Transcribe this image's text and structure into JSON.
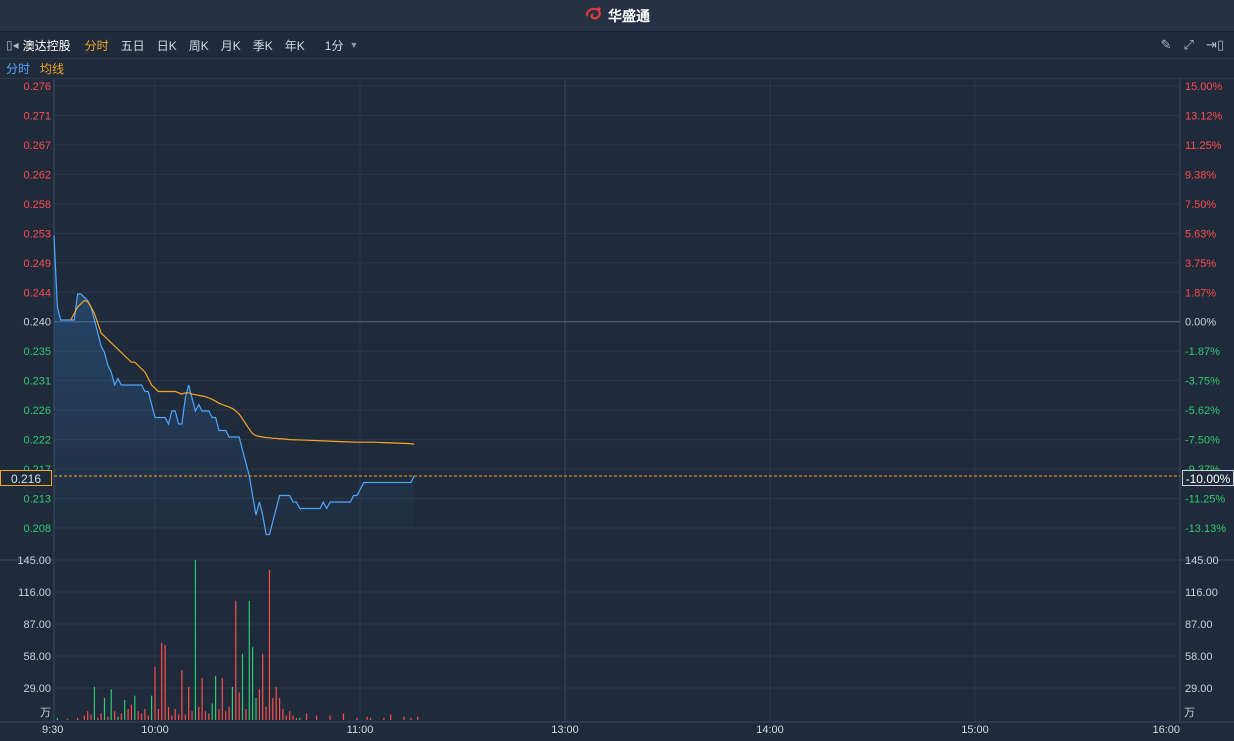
{
  "brand": {
    "name": "华盛通",
    "logo_icon": "huasheng-logo-icon"
  },
  "toolbar": {
    "stock_name": "澳达控股",
    "tabs": [
      "分时",
      "五日",
      "日K",
      "周K",
      "月K",
      "季K",
      "年K"
    ],
    "active_tab": "分时",
    "period": "1分",
    "icons": [
      "collapse-panel-icon",
      "pencil-icon",
      "fullscreen-icon",
      "exit-icon"
    ]
  },
  "legend": {
    "series1": "分时",
    "series2": "均线"
  },
  "colors": {
    "price_line": "#4fa8ff",
    "avg_line": "#f5a623",
    "up": "#ff4d4d",
    "down": "#2ecc71",
    "baseline": "#5a6b80",
    "grid": "#2b3849"
  },
  "chart_data": {
    "type": "line",
    "prev_close": 0.24,
    "price_ticks_left": [
      "0.276",
      "0.271",
      "0.267",
      "0.262",
      "0.258",
      "0.253",
      "0.249",
      "0.244",
      "0.240",
      "0.235",
      "0.231",
      "0.226",
      "0.222",
      "0.217",
      "0.213",
      "0.208"
    ],
    "pct_ticks_right": [
      "15.00%",
      "13.12%",
      "11.25%",
      "9.38%",
      "7.50%",
      "5.63%",
      "3.75%",
      "1.87%",
      "0.00%",
      "-1.87%",
      "-3.75%",
      "-5.62%",
      "-7.50%",
      "-9.37%",
      "-11.25%",
      "-13.13%"
    ],
    "volume_ticks": [
      "145.00",
      "116.00",
      "87.00",
      "58.00",
      "29.00"
    ],
    "volume_unit": "万",
    "x_labels": [
      "9:30",
      "10:00",
      "11:00",
      "13:00",
      "14:00",
      "15:00",
      "16:00"
    ],
    "current_price": "0.216",
    "current_pct": "-10.00%",
    "price_series": [
      [
        0,
        0.253
      ],
      [
        1,
        0.242
      ],
      [
        2,
        0.24
      ],
      [
        3,
        0.24
      ],
      [
        4,
        0.24
      ],
      [
        5,
        0.24
      ],
      [
        6,
        0.24
      ],
      [
        7,
        0.244
      ],
      [
        8,
        0.244
      ],
      [
        9,
        0.2435
      ],
      [
        10,
        0.243
      ],
      [
        11,
        0.242
      ],
      [
        12,
        0.24
      ],
      [
        13,
        0.238
      ],
      [
        14,
        0.236
      ],
      [
        15,
        0.235
      ],
      [
        16,
        0.233
      ],
      [
        17,
        0.232
      ],
      [
        18,
        0.23
      ],
      [
        19,
        0.231
      ],
      [
        20,
        0.23
      ],
      [
        21,
        0.23
      ],
      [
        22,
        0.23
      ],
      [
        23,
        0.23
      ],
      [
        24,
        0.23
      ],
      [
        25,
        0.23
      ],
      [
        26,
        0.23
      ],
      [
        27,
        0.229
      ],
      [
        28,
        0.229
      ],
      [
        29,
        0.227
      ],
      [
        30,
        0.225
      ],
      [
        31,
        0.225
      ],
      [
        32,
        0.225
      ],
      [
        33,
        0.225
      ],
      [
        34,
        0.224
      ],
      [
        35,
        0.226
      ],
      [
        36,
        0.226
      ],
      [
        37,
        0.224
      ],
      [
        38,
        0.224
      ],
      [
        39,
        0.228
      ],
      [
        40,
        0.23
      ],
      [
        41,
        0.228
      ],
      [
        42,
        0.226
      ],
      [
        43,
        0.227
      ],
      [
        44,
        0.226
      ],
      [
        45,
        0.226
      ],
      [
        46,
        0.226
      ],
      [
        47,
        0.225
      ],
      [
        48,
        0.225
      ],
      [
        49,
        0.223
      ],
      [
        50,
        0.223
      ],
      [
        51,
        0.223
      ],
      [
        52,
        0.222
      ],
      [
        53,
        0.222
      ],
      [
        54,
        0.222
      ],
      [
        55,
        0.222
      ],
      [
        56,
        0.22
      ],
      [
        57,
        0.218
      ],
      [
        58,
        0.216
      ],
      [
        59,
        0.213
      ],
      [
        60,
        0.21
      ],
      [
        61,
        0.212
      ],
      [
        62,
        0.21
      ],
      [
        63,
        0.207
      ],
      [
        64,
        0.207
      ],
      [
        65,
        0.209
      ],
      [
        66,
        0.211
      ],
      [
        67,
        0.213
      ],
      [
        68,
        0.213
      ],
      [
        69,
        0.213
      ],
      [
        70,
        0.213
      ],
      [
        71,
        0.212
      ],
      [
        72,
        0.212
      ],
      [
        73,
        0.211
      ],
      [
        74,
        0.211
      ],
      [
        75,
        0.211
      ],
      [
        76,
        0.211
      ],
      [
        77,
        0.211
      ],
      [
        78,
        0.211
      ],
      [
        79,
        0.211
      ],
      [
        80,
        0.212
      ],
      [
        81,
        0.211
      ],
      [
        82,
        0.212
      ],
      [
        83,
        0.212
      ],
      [
        84,
        0.212
      ],
      [
        85,
        0.212
      ],
      [
        86,
        0.212
      ],
      [
        87,
        0.212
      ],
      [
        88,
        0.212
      ],
      [
        89,
        0.213
      ],
      [
        90,
        0.213
      ],
      [
        91,
        0.214
      ],
      [
        92,
        0.215
      ],
      [
        93,
        0.215
      ],
      [
        94,
        0.215
      ],
      [
        95,
        0.215
      ],
      [
        96,
        0.215
      ],
      [
        97,
        0.215
      ],
      [
        98,
        0.215
      ],
      [
        99,
        0.215
      ],
      [
        100,
        0.215
      ],
      [
        101,
        0.215
      ],
      [
        102,
        0.215
      ],
      [
        103,
        0.215
      ],
      [
        104,
        0.215
      ],
      [
        105,
        0.215
      ],
      [
        106,
        0.215
      ],
      [
        107,
        0.216
      ]
    ],
    "avg_series": [
      [
        5,
        0.24
      ],
      [
        6,
        0.241
      ],
      [
        7,
        0.242
      ],
      [
        8,
        0.2425
      ],
      [
        9,
        0.243
      ],
      [
        10,
        0.2428
      ],
      [
        11,
        0.242
      ],
      [
        12,
        0.241
      ],
      [
        13,
        0.2395
      ],
      [
        14,
        0.238
      ],
      [
        15,
        0.2375
      ],
      [
        16,
        0.237
      ],
      [
        17,
        0.2365
      ],
      [
        18,
        0.236
      ],
      [
        19,
        0.2355
      ],
      [
        20,
        0.235
      ],
      [
        21,
        0.2345
      ],
      [
        22,
        0.234
      ],
      [
        23,
        0.2335
      ],
      [
        24,
        0.2335
      ],
      [
        25,
        0.233
      ],
      [
        26,
        0.2325
      ],
      [
        27,
        0.232
      ],
      [
        28,
        0.231
      ],
      [
        29,
        0.23
      ],
      [
        30,
        0.2295
      ],
      [
        31,
        0.229
      ],
      [
        32,
        0.229
      ],
      [
        33,
        0.229
      ],
      [
        34,
        0.229
      ],
      [
        35,
        0.229
      ],
      [
        36,
        0.229
      ],
      [
        37,
        0.2288
      ],
      [
        38,
        0.2286
      ],
      [
        39,
        0.2288
      ],
      [
        40,
        0.2288
      ],
      [
        41,
        0.2286
      ],
      [
        42,
        0.2285
      ],
      [
        43,
        0.2284
      ],
      [
        44,
        0.2283
      ],
      [
        45,
        0.2282
      ],
      [
        46,
        0.228
      ],
      [
        47,
        0.2278
      ],
      [
        48,
        0.2275
      ],
      [
        49,
        0.2272
      ],
      [
        50,
        0.227
      ],
      [
        51,
        0.2268
      ],
      [
        52,
        0.2266
      ],
      [
        53,
        0.2264
      ],
      [
        54,
        0.226
      ],
      [
        55,
        0.2255
      ],
      [
        56,
        0.2248
      ],
      [
        57,
        0.224
      ],
      [
        58,
        0.2232
      ],
      [
        59,
        0.2225
      ],
      [
        60,
        0.2222
      ],
      [
        61,
        0.2221
      ],
      [
        62,
        0.222
      ],
      [
        63,
        0.2219
      ],
      [
        64,
        0.2219
      ],
      [
        65,
        0.2218
      ],
      [
        66,
        0.2218
      ],
      [
        67,
        0.2217
      ],
      [
        68,
        0.2217
      ],
      [
        70,
        0.2216
      ],
      [
        75,
        0.2215
      ],
      [
        80,
        0.2214
      ],
      [
        85,
        0.2213
      ],
      [
        90,
        0.2212
      ],
      [
        95,
        0.2212
      ],
      [
        100,
        0.2211
      ],
      [
        105,
        0.221
      ],
      [
        107,
        0.2209
      ]
    ],
    "volume_series": [
      [
        1,
        2,
        "down"
      ],
      [
        4,
        1,
        "up"
      ],
      [
        7,
        2,
        "up"
      ],
      [
        9,
        4,
        "up"
      ],
      [
        10,
        8,
        "up"
      ],
      [
        11,
        5,
        "up"
      ],
      [
        12,
        30,
        "down"
      ],
      [
        13,
        2,
        "up"
      ],
      [
        14,
        6,
        "up"
      ],
      [
        15,
        20,
        "down"
      ],
      [
        16,
        3,
        "up"
      ],
      [
        17,
        28,
        "down"
      ],
      [
        18,
        8,
        "up"
      ],
      [
        19,
        3,
        "down"
      ],
      [
        20,
        6,
        "up"
      ],
      [
        21,
        18,
        "down"
      ],
      [
        22,
        10,
        "up"
      ],
      [
        23,
        14,
        "up"
      ],
      [
        24,
        22,
        "down"
      ],
      [
        25,
        8,
        "up"
      ],
      [
        26,
        6,
        "up"
      ],
      [
        27,
        10,
        "up"
      ],
      [
        28,
        4,
        "up"
      ],
      [
        29,
        22,
        "down"
      ],
      [
        30,
        48,
        "up"
      ],
      [
        31,
        10,
        "up"
      ],
      [
        32,
        70,
        "up"
      ],
      [
        33,
        68,
        "up"
      ],
      [
        34,
        12,
        "up"
      ],
      [
        35,
        4,
        "up"
      ],
      [
        36,
        10,
        "up"
      ],
      [
        37,
        5,
        "up"
      ],
      [
        38,
        45,
        "up"
      ],
      [
        39,
        5,
        "up"
      ],
      [
        40,
        30,
        "up"
      ],
      [
        41,
        8,
        "up"
      ],
      [
        42,
        145,
        "down"
      ],
      [
        43,
        12,
        "up"
      ],
      [
        44,
        38,
        "up"
      ],
      [
        45,
        8,
        "up"
      ],
      [
        46,
        6,
        "up"
      ],
      [
        47,
        15,
        "down"
      ],
      [
        48,
        40,
        "down"
      ],
      [
        49,
        10,
        "up"
      ],
      [
        50,
        38,
        "up"
      ],
      [
        51,
        8,
        "up"
      ],
      [
        52,
        12,
        "up"
      ],
      [
        53,
        30,
        "down"
      ],
      [
        54,
        108,
        "up"
      ],
      [
        55,
        25,
        "up"
      ],
      [
        56,
        60,
        "down"
      ],
      [
        57,
        10,
        "up"
      ],
      [
        58,
        108,
        "down"
      ],
      [
        59,
        66,
        "down"
      ],
      [
        60,
        20,
        "down"
      ],
      [
        61,
        28,
        "up"
      ],
      [
        62,
        60,
        "up"
      ],
      [
        63,
        12,
        "up"
      ],
      [
        64,
        136,
        "up"
      ],
      [
        65,
        20,
        "up"
      ],
      [
        66,
        30,
        "up"
      ],
      [
        67,
        20,
        "up"
      ],
      [
        68,
        10,
        "up"
      ],
      [
        69,
        4,
        "up"
      ],
      [
        70,
        8,
        "up"
      ],
      [
        71,
        4,
        "up"
      ],
      [
        72,
        2,
        "up"
      ],
      [
        73,
        2,
        "down"
      ],
      [
        75,
        6,
        "up"
      ],
      [
        78,
        4,
        "up"
      ],
      [
        82,
        4,
        "up"
      ],
      [
        86,
        6,
        "up"
      ],
      [
        90,
        2,
        "up"
      ],
      [
        93,
        3,
        "up"
      ],
      [
        94,
        2,
        "up"
      ],
      [
        98,
        2,
        "up"
      ],
      [
        100,
        5,
        "up"
      ],
      [
        104,
        3,
        "up"
      ],
      [
        106,
        2,
        "up"
      ],
      [
        108,
        3,
        "up"
      ]
    ]
  }
}
